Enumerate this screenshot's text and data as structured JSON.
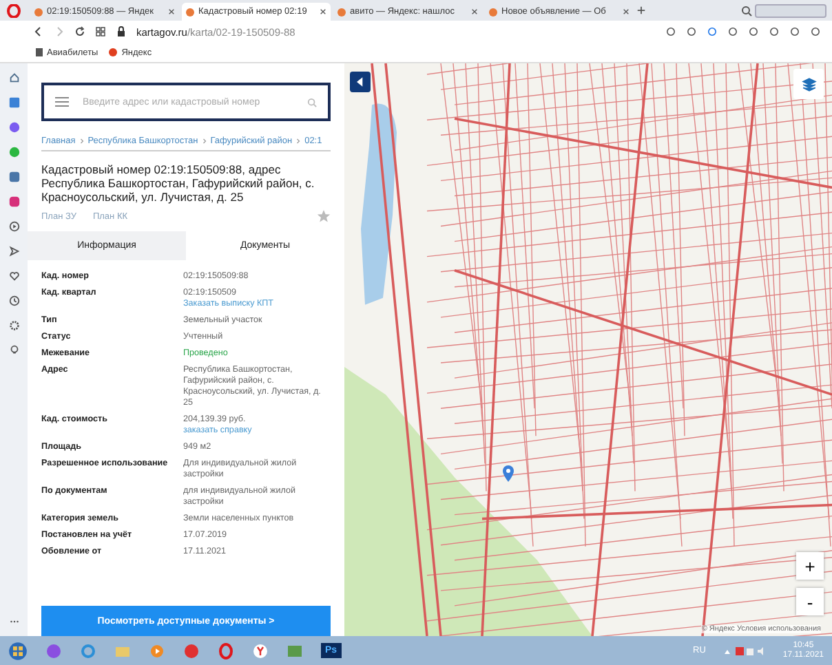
{
  "browser": {
    "tabs": [
      {
        "title": "02:19:150509:88 — Яндек",
        "selected": false
      },
      {
        "title": "Кадастровый номер 02:19",
        "selected": true
      },
      {
        "title": "авито — Яндекс: нашлос",
        "selected": false
      },
      {
        "title": "Новое объявление — Об",
        "selected": false
      }
    ],
    "url_domain": "kartagov.ru",
    "url_path": "/karta/02-19-150509-88",
    "bookmarks": [
      "Авиабилеты",
      "Яндекс"
    ]
  },
  "panel": {
    "search": {
      "placeholder": "Введите адрес или кадастровый номер"
    },
    "breadcrumbs": [
      "Главная",
      "Республика Башкортостан",
      "Гафурийский район",
      "02:1"
    ],
    "title": "Кадастровый номер 02:19:150509:88, адрес Республика Башкортостан, Гафурийский район, с. Красноусольский, ул. Лучистая, д. 25",
    "plan_links": [
      {
        "label": "План ЗУ",
        "disabled": true
      },
      {
        "label": "План КК",
        "disabled": true
      }
    ],
    "favorite": false,
    "tabs": [
      {
        "label": "Информация",
        "selected": true
      },
      {
        "label": "Документы",
        "selected": false
      }
    ],
    "rows": [
      {
        "label": "Кад. номер",
        "value": "02:19:150509:88",
        "positive": false
      },
      {
        "label": "Кад. квартал",
        "value": "02:19:150509",
        "link": "Заказать выписку КПТ",
        "positive": false
      },
      {
        "label": "Тип",
        "value": "Земельный участок",
        "positive": false
      },
      {
        "label": "Статус",
        "value": "Учтенный",
        "positive": false
      },
      {
        "label": "Межевание",
        "value": "Проведено",
        "positive": true
      },
      {
        "label": "Адрес",
        "value": "Республика Башкортостан, Гафурийский район, с. Красноусольский, ул. Лучистая, д. 25",
        "positive": false
      },
      {
        "label": "Кад. стоимость",
        "value": "204,139.39 руб.",
        "link": "заказать справку",
        "positive": false
      },
      {
        "label": "Площадь",
        "value": "949 м2",
        "positive": false
      },
      {
        "label": "Разрешенное использование",
        "value": "Для индивидуальной жилой застройки",
        "positive": false
      },
      {
        "label": "По документам",
        "value": "для индивидуальной жилой застройки",
        "positive": false
      },
      {
        "label": "Категория земель",
        "value": "Земли населенных пунктов",
        "positive": false
      },
      {
        "label": "Постановлен на учёт",
        "value": "17.07.2019",
        "positive": false
      },
      {
        "label": "Обовление от",
        "value": "17.11.2021",
        "positive": false
      }
    ],
    "button": "Посмотреть доступные документы >"
  },
  "map": {
    "zoom_in": "+",
    "zoom_out": "-",
    "copyright": "© Яндекс Условия использования"
  },
  "taskbar": {
    "ps_label": "Ps",
    "language": "RU",
    "time": "10:45",
    "date": "17.11.2021"
  }
}
